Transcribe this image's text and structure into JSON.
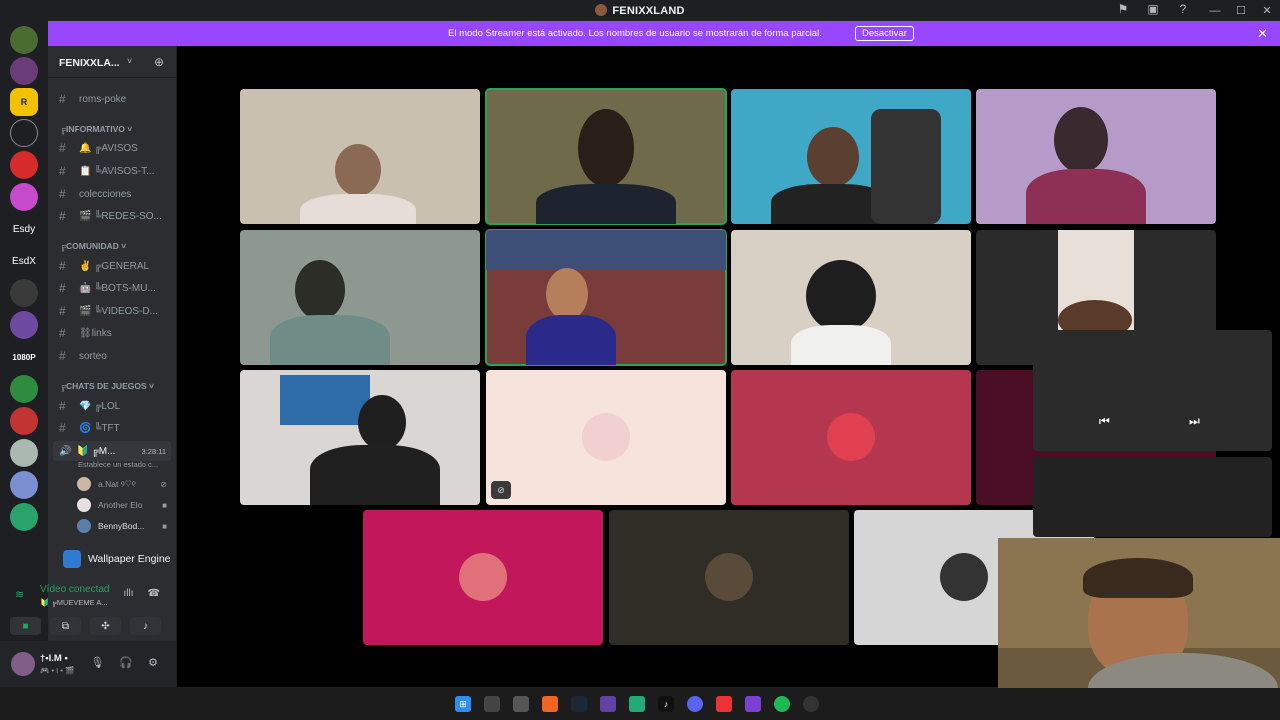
{
  "window": {
    "title": "FENIXXLAND",
    "controls": {
      "minimize": "—",
      "maximize": "☐",
      "close": "✕"
    }
  },
  "toolbar_icons": [
    "inbox-icon",
    "monitor-icon",
    "help-icon"
  ],
  "banner": {
    "text": "El modo Streamer está activado. Los nombres de usuario se mostrarán de forma parcial.",
    "button": "Desactivar",
    "close": "✕",
    "color": "#9747ff"
  },
  "guilds": [
    {
      "label": ""
    },
    {
      "label": ""
    },
    {
      "label": "R"
    },
    {
      "label": ""
    },
    {
      "label": ""
    },
    {
      "label": ""
    },
    {
      "label": "Esdy"
    },
    {
      "label": "EsdX"
    },
    {
      "label": ""
    },
    {
      "label": ""
    },
    {
      "label": "1080P"
    },
    {
      "label": ""
    },
    {
      "label": ""
    },
    {
      "label": ""
    },
    {
      "label": ""
    },
    {
      "label": ""
    }
  ],
  "sidebar": {
    "server_name": "FENIXXLA...",
    "channels_top": [
      {
        "label": "roms-poke"
      }
    ],
    "category_info": "╔INFORMATIVO ˅",
    "channels_info": [
      {
        "label": "🔔 ╔AVISOS"
      },
      {
        "label": "📋 ╚AVISOS-T..."
      },
      {
        "label": "colecciones"
      },
      {
        "label": "🎬 ╚REDES-SO..."
      }
    ],
    "category_comunidad": "╔COMUNIDAD ˅",
    "channels_comunidad": [
      {
        "label": "✌ ╔GENERAL"
      },
      {
        "label": "🤖 ╚BOTS-MU..."
      },
      {
        "label": "🎬 ╚VIDEOS-D..."
      },
      {
        "label": "⛓links"
      },
      {
        "label": "sorteo"
      }
    ],
    "category_juegos": "╔CHATS DE JUEGOS ˅",
    "channels_juegos": [
      {
        "label": "💎 ╔LOL"
      },
      {
        "label": "🌀 ╚TFT"
      }
    ],
    "voice_channel": {
      "label": "🔰 ╔M...",
      "time": "3:28:11",
      "subtitle": "Establece un estado c..."
    },
    "members": [
      {
        "name": "a.Nat ୨♡୧",
        "icon": "muted-icon"
      },
      {
        "name": "Another Elo",
        "icon": "camera-icon"
      },
      {
        "name": "BennyBod...",
        "icon": "camera-icon"
      }
    ]
  },
  "activity": {
    "name": "Wallpaper Engine"
  },
  "voice_panel": {
    "status": "Vídeo conectad",
    "channel": "🔰 ╔MUEVEME A...",
    "buttons": [
      "camera-icon",
      "screen-share-icon",
      "activities-icon",
      "soundboard-icon"
    ]
  },
  "user_panel": {
    "name": "†•I.M •",
    "status": "🎮 • I • 🎬"
  },
  "stage": {
    "tiles": [
      {
        "bg": "#c9c0b0",
        "speaking": false
      },
      {
        "bg": "#6f6a4a",
        "speaking": true
      },
      {
        "bg": "#3fa8c6",
        "speaking": false
      },
      {
        "bg": "#b69bc9",
        "speaking": false
      },
      {
        "bg": "#8c9890",
        "speaking": false
      },
      {
        "bg": "#7a3b3b",
        "speaking": true
      },
      {
        "bg": "#d8d0c4",
        "speaking": false
      },
      {
        "bg": "#3a3a3a",
        "speaking": false
      },
      {
        "bg": "#d9d6d3",
        "speaking": false
      },
      {
        "bg": "#f5e3dc",
        "speaking": false,
        "muted": true
      },
      {
        "bg": "#b5374f",
        "speaking": false
      },
      {
        "bg": "#4a0f24",
        "speaking": false
      },
      {
        "bg": "#c2185b",
        "speaking": false
      },
      {
        "bg": "#2f2d25",
        "speaking": false
      },
      {
        "bg": "#d6d6d6",
        "speaking": false
      }
    ]
  },
  "overlay": {
    "prev": "⏮",
    "next": "⏭"
  },
  "taskbar": [
    "windows-icon",
    "explorer-icon",
    "store-icon",
    "app-icon",
    "steam-icon",
    "twitch-icon",
    "app2-icon",
    "tiktok-icon",
    "discord-icon",
    "app3-icon",
    "app4-icon",
    "spotify-icon",
    "app5-icon"
  ]
}
